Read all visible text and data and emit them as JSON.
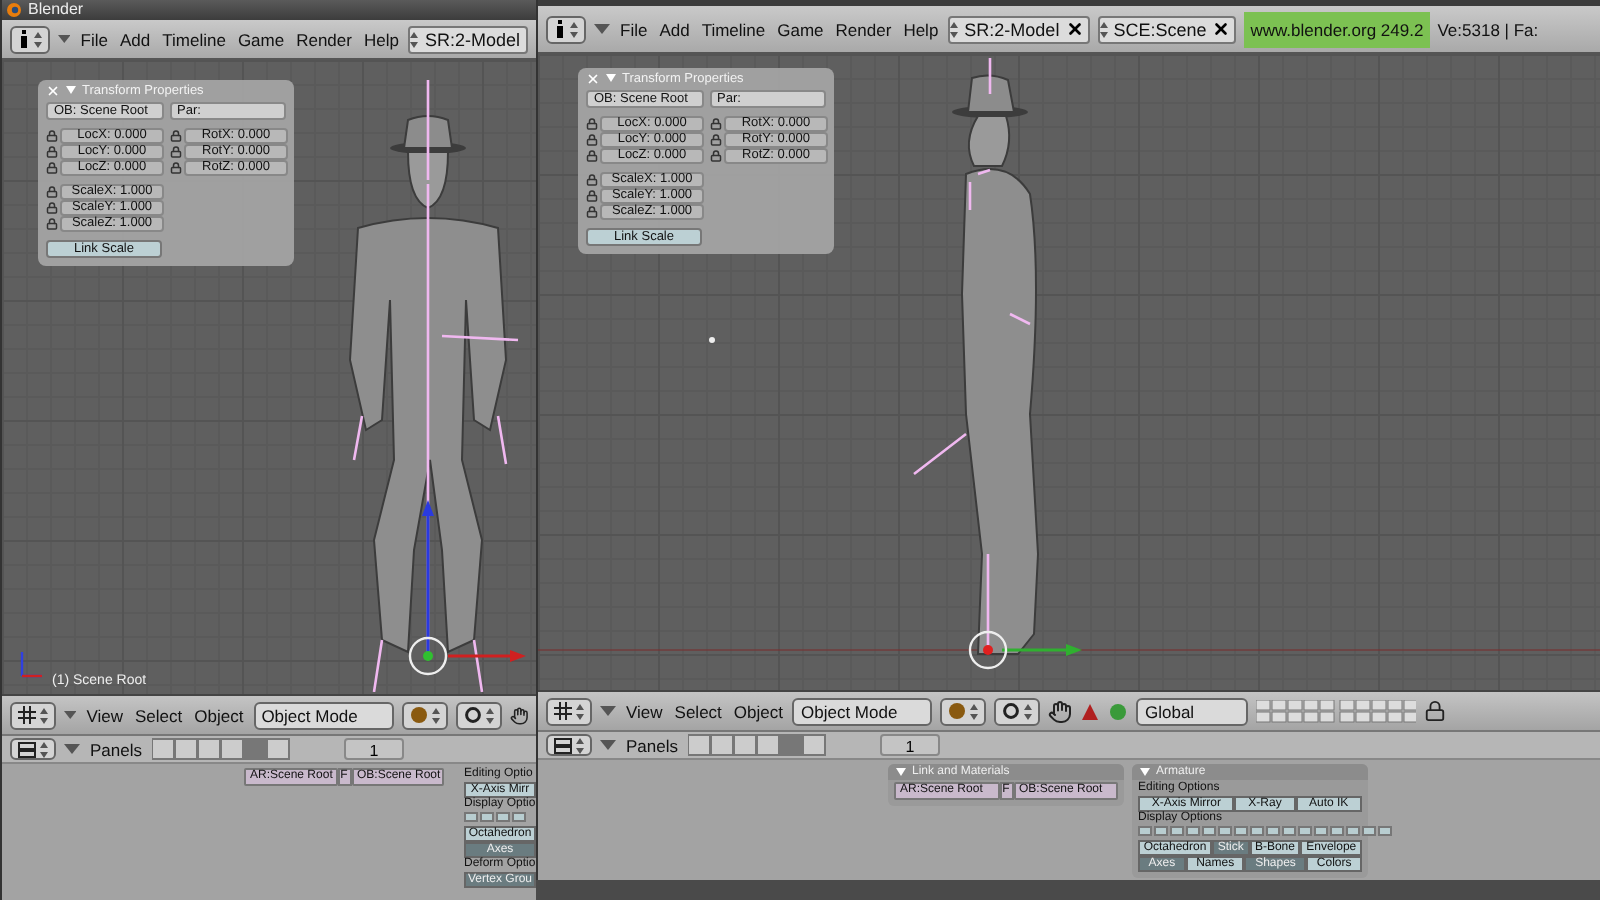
{
  "windows": [
    {
      "kind": "front",
      "title": "Blender",
      "menu": [
        "File",
        "Add",
        "Timeline",
        "Game",
        "Render",
        "Help"
      ],
      "header_fields": [
        {
          "label": "SR:2-Model",
          "closable": false
        }
      ],
      "transform": {
        "title": "Transform Properties",
        "object": "OB: Scene Root",
        "parent": "Par:",
        "location": [
          "LocX: 0.000",
          "LocY: 0.000",
          "LocZ: 0.000"
        ],
        "rotation": [
          "RotX: 0.000",
          "RotY: 0.000",
          "RotZ: 0.000"
        ],
        "scale": [
          "ScaleX: 1.000",
          "ScaleY: 1.000",
          "ScaleZ: 1.000"
        ],
        "link_button": "Link Scale"
      },
      "viewport_label": "(1) Scene Root",
      "view_header": {
        "menu": [
          "View",
          "Select",
          "Object"
        ],
        "mode": "Object Mode"
      },
      "buttons_header": {
        "label": "Panels",
        "page": "1"
      },
      "link_fields": [
        {
          "label": "AR:Scene Root"
        },
        {
          "prefix": "F",
          "label": "OB:Scene Root"
        }
      ],
      "armature": {
        "editing_label": "Editing Optio",
        "editing_buttons": [
          {
            "label": "X-Axis Mirr",
            "selected": false
          }
        ],
        "display_label": "Display Optio",
        "draw_types": [
          {
            "label": "Octahedron",
            "selected": false
          }
        ],
        "draw_flags": [
          {
            "label": "Axes",
            "selected": true
          }
        ],
        "deform_label": "Deform Optio",
        "deform_buttons": [
          {
            "label": "Vertex Grou",
            "selected": true
          }
        ]
      }
    },
    {
      "kind": "side",
      "menu": [
        "File",
        "Add",
        "Timeline",
        "Game",
        "Render",
        "Help"
      ],
      "header_fields": [
        {
          "label": "SR:2-Model",
          "closable": true
        },
        {
          "label": "SCE:Scene",
          "closable": true
        }
      ],
      "version": "www.blender.org 249.2",
      "stats": "Ve:5318 | Fa:",
      "transform": {
        "title": "Transform Properties",
        "object": "OB: Scene Root",
        "parent": "Par:",
        "location": [
          "LocX: 0.000",
          "LocY: 0.000",
          "LocZ: 0.000"
        ],
        "rotation": [
          "RotX: 0.000",
          "RotY: 0.000",
          "RotZ: 0.000"
        ],
        "scale": [
          "ScaleX: 1.000",
          "ScaleY: 1.000",
          "ScaleZ: 1.000"
        ],
        "link_button": "Link Scale"
      },
      "view_header": {
        "menu": [
          "View",
          "Select",
          "Object"
        ],
        "mode": "Object Mode",
        "orientation": "Global"
      },
      "buttons_header": {
        "label": "Panels",
        "page": "1"
      },
      "link_title": "Link and Materials",
      "link_fields": [
        {
          "label": "AR:Scene Root"
        },
        {
          "prefix": "F",
          "label": "OB:Scene Root"
        }
      ],
      "armature": {
        "title": "Armature",
        "editing_label": "Editing Options",
        "editing_buttons": [
          {
            "label": "X-Axis Mirror",
            "selected": false
          },
          {
            "label": "X-Ray",
            "selected": false
          },
          {
            "label": "Auto IK",
            "selected": false
          }
        ],
        "display_label": "Display Options",
        "draw_types": [
          {
            "label": "Octahedron",
            "selected": false
          },
          {
            "label": "Stick",
            "selected": true
          },
          {
            "label": "B-Bone",
            "selected": false
          },
          {
            "label": "Envelope",
            "selected": false
          }
        ],
        "draw_flags": [
          {
            "label": "Axes",
            "selected": true
          },
          {
            "label": "Names",
            "selected": false
          },
          {
            "label": "Shapes",
            "selected": true
          },
          {
            "label": "Colors",
            "selected": false
          }
        ]
      }
    }
  ]
}
